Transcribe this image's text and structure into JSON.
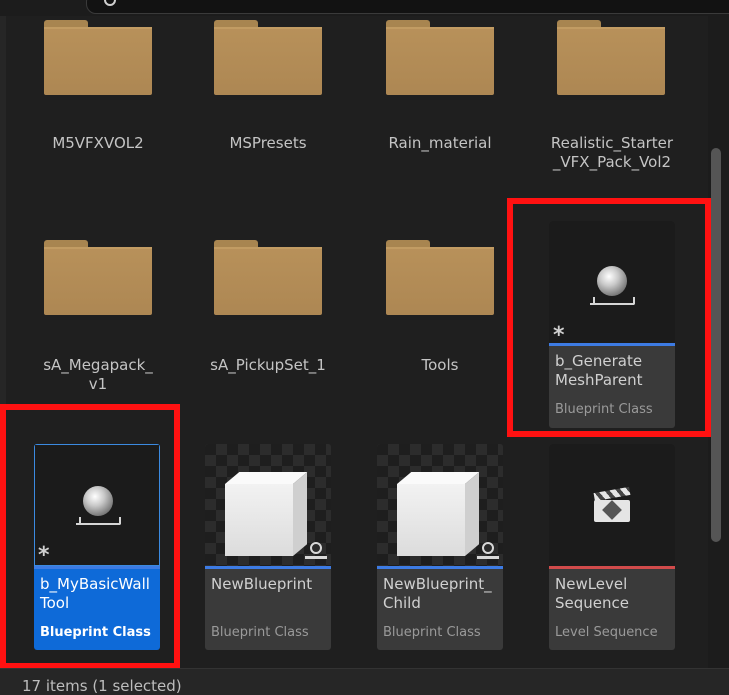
{
  "folders": [
    {
      "label": "M5VFXVOL2"
    },
    {
      "label": "MSPresets"
    },
    {
      "label": "Rain_material"
    },
    {
      "label": "Realistic_Starter\n_VFX_Pack_Vol2"
    },
    {
      "label": "sA_Megapack_\nv1"
    },
    {
      "label": "sA_PickupSet_1"
    },
    {
      "label": "Tools"
    }
  ],
  "assets": [
    {
      "name": "b_Generate\nMeshParent",
      "type": "Blueprint Class",
      "icon": "sphere-icon",
      "stripe": "#3d7be3",
      "selected": false,
      "highlighted": true
    },
    {
      "name": "b_MyBasicWall\nTool",
      "type": "Blueprint Class",
      "icon": "sphere-icon",
      "stripe": "#3d7be3",
      "selected": true,
      "highlighted": true
    },
    {
      "name": "NewBlueprint",
      "type": "Blueprint Class",
      "icon": "cube-icon",
      "stripe": "#3d7be3",
      "selected": false,
      "highlighted": false
    },
    {
      "name": "NewBlueprint_\nChild",
      "type": "Blueprint Class",
      "icon": "cube-icon",
      "stripe": "#3d7be3",
      "selected": false,
      "highlighted": false
    },
    {
      "name": "NewLevel\nSequence",
      "type": "Level Sequence",
      "icon": "clapper-icon",
      "stripe": "#d14b4b",
      "selected": false,
      "highlighted": false
    }
  ],
  "status": {
    "text": "17 items (1 selected)"
  },
  "colors": {
    "selected": "#0e6ad8",
    "highlight": "#ff1111",
    "folder": "#b8915a"
  }
}
